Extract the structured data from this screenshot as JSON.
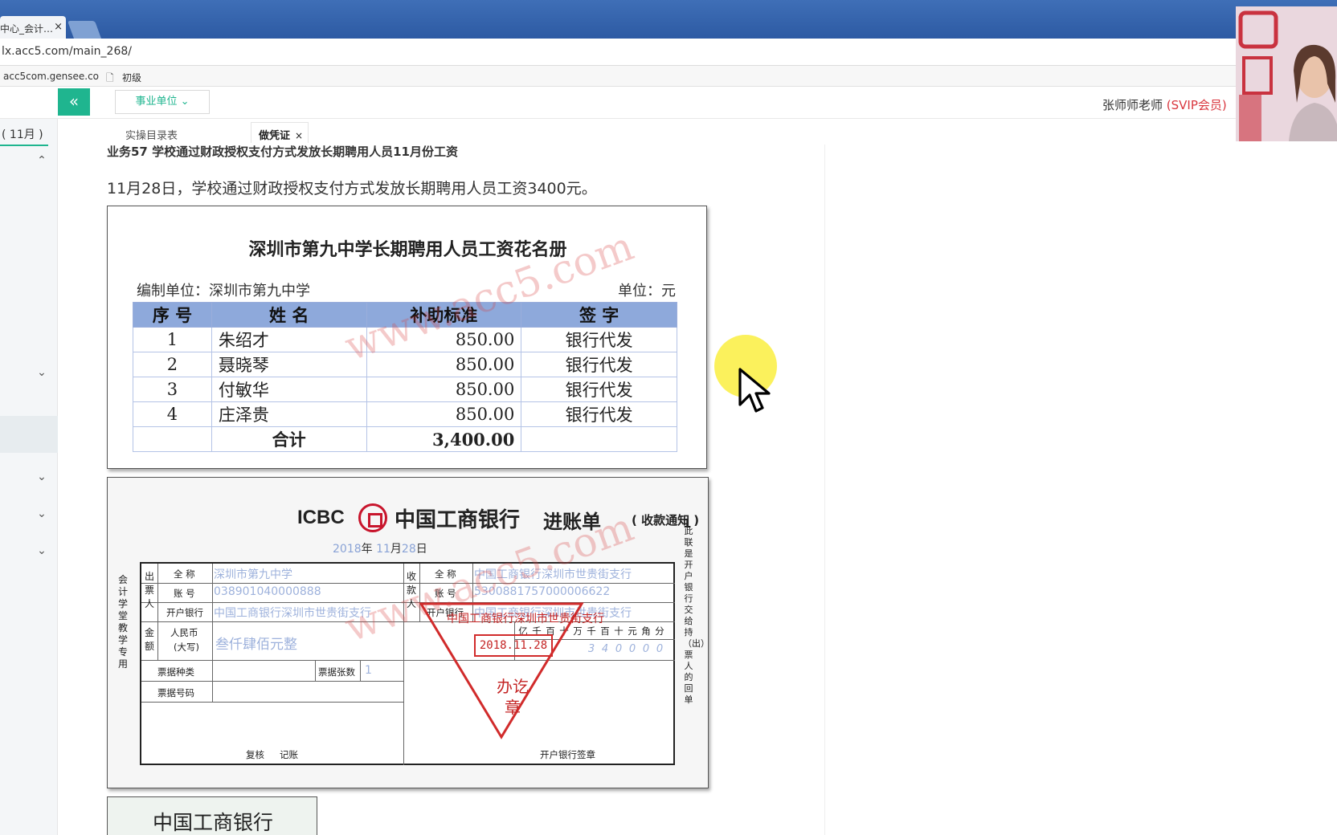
{
  "browser": {
    "tab_title": "中心_会计…",
    "tab_close": "×",
    "url": "lx.acc5.com/main_268/",
    "bookmarks": [
      "acc5com.gensee.co",
      "初级"
    ]
  },
  "header": {
    "collapse_label": "«",
    "unit_select": "事业单位 ⌄",
    "teacher_name": "张师师老师",
    "teacher_badge": "(SVIP会员)"
  },
  "sidebar": {
    "month": "( 11月 )"
  },
  "content_tabs": [
    {
      "label": "实操目录表"
    },
    {
      "label": "做凭证",
      "close": "×"
    }
  ],
  "task": {
    "title": "业务57 学校通过财政授权支付方式发放长期聘用人员11月份工资",
    "description": "11月28日，学校通过财政授权支付方式发放长期聘用人员工资3400元。"
  },
  "payroll": {
    "title": "深圳市第九中学长期聘用人员工资花名册",
    "org": "编制单位：深圳市第九中学",
    "unit": "单位：元",
    "headers": [
      "序  号",
      "姓  名",
      "补助标准",
      "签  字"
    ],
    "rows": [
      {
        "no": "1",
        "name": "朱绍才",
        "amount": "850.00",
        "sign": "银行代发"
      },
      {
        "no": "2",
        "name": "聂晓琴",
        "amount": "850.00",
        "sign": "银行代发"
      },
      {
        "no": "3",
        "name": "付敏华",
        "amount": "850.00",
        "sign": "银行代发"
      },
      {
        "no": "4",
        "name": "庄泽贵",
        "amount": "850.00",
        "sign": "银行代发"
      }
    ],
    "total_label": "合计",
    "total_amount": "3,400.00"
  },
  "watermark": "www.acc5.com",
  "slip": {
    "bank_en": "ICBC",
    "bank_cn": "中国工商银行",
    "name": "进账单",
    "subtitle": "( 收款通知 )",
    "copy_no": "1",
    "date_year": "2018",
    "date_month": "11",
    "date_day": "28",
    "date_year_unit": "年",
    "date_month_unit": "月",
    "date_day_unit": "日",
    "payer_group": "出票人",
    "payee_group": "收款人",
    "amount_group": "金额",
    "full_name_label": "全 称",
    "account_label": "账 号",
    "bank_label": "开户银行",
    "payer_name": "深圳市第九中学",
    "payer_account": "038901040000888",
    "payer_bank": "中国工商银行深圳市世贵街支行",
    "payee_name": "中国工商银行深圳市世贵街支行",
    "payee_account": "5300881757000006622",
    "payee_bank": "中国工商银行深圳市世贵街支行",
    "rmb_label": "人民币",
    "rmb_sub": "(大写)",
    "amount_words": "叁仟肆佰元整",
    "digit_headers": [
      "亿",
      "千",
      "百",
      "十",
      "万",
      "千",
      "百",
      "十",
      "元",
      "角",
      "分"
    ],
    "amount_digits": [
      "",
      "",
      "",
      "",
      "",
      "",
      "3",
      "4",
      "0",
      "0",
      "0",
      "0"
    ],
    "stamp_date": "2018.11.28",
    "stamp_text": "办讫章",
    "stamp_bank": "中国工商银行深圳市世贵街支行",
    "bill_type_label": "票据种类",
    "bill_count_label": "票据张数",
    "bill_count": "1",
    "bill_no_label": "票据号码",
    "review_label": "复核",
    "record_label": "记账",
    "bank_sign_label": "开户银行签章",
    "left_note": "会计学堂教学专用",
    "right_note": "此联是开户银行交给持（出）票人的回单"
  },
  "next_doc": {
    "title": "中国工商银行"
  }
}
